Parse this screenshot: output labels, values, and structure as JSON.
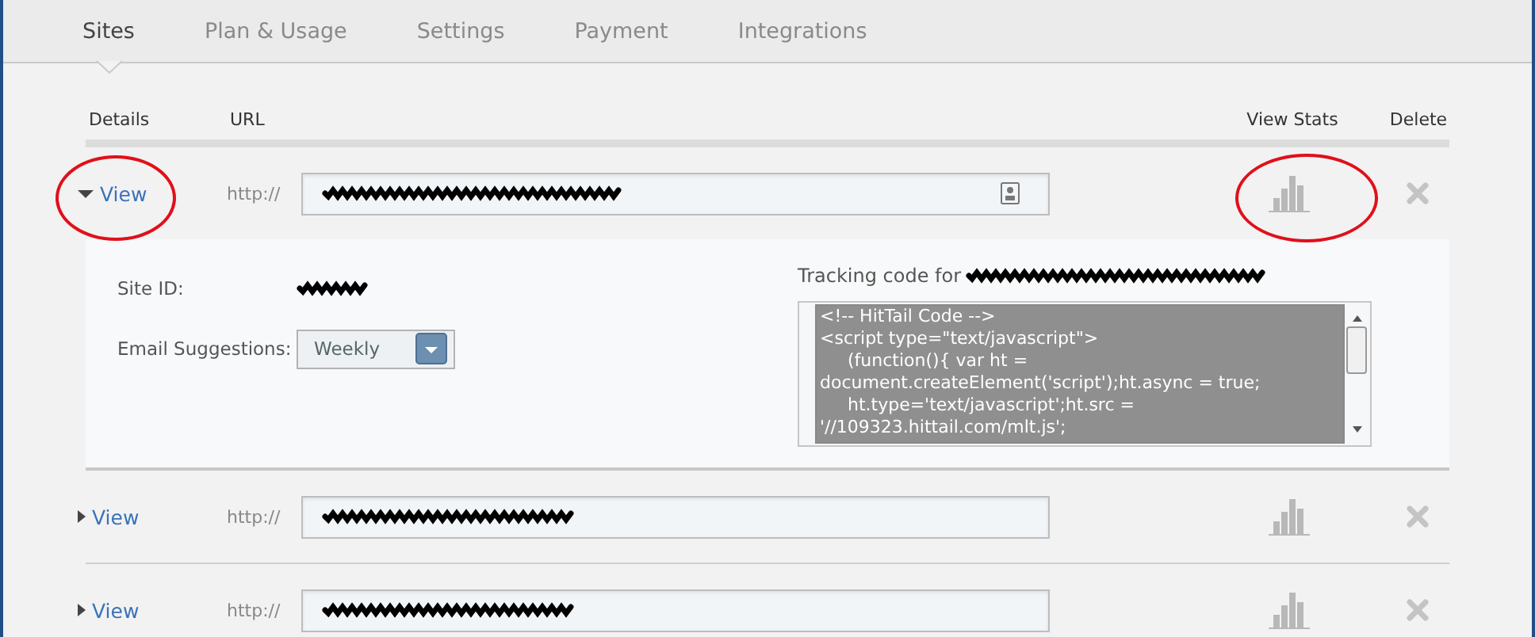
{
  "tabs": [
    {
      "label": "Sites",
      "selected": true
    },
    {
      "label": "Plan & Usage",
      "selected": false
    },
    {
      "label": "Settings",
      "selected": false
    },
    {
      "label": "Payment",
      "selected": false
    },
    {
      "label": "Integrations",
      "selected": false
    }
  ],
  "columns": [
    "Details",
    "URL",
    "View Stats",
    "Delete"
  ],
  "sites": [
    {
      "toggle": "View",
      "expanded": true,
      "prefix": "http://",
      "view_circled": true,
      "stats_circled": true,
      "details": {
        "site_id_label": "Site ID:",
        "email_label": "Email Suggestions:",
        "email_value": "Weekly",
        "tracking_label": "Tracking code for",
        "code_lines": [
          "<!-- HitTail Code -->",
          "<script type=\"text/javascript\">",
          "     (function(){ var ht =",
          "document.createElement('script');ht.async = true;",
          "     ht.type='text/javascript';ht.src =",
          "'//109323.hittail.com/mlt.js';"
        ]
      }
    },
    {
      "toggle": "View",
      "expanded": false,
      "prefix": "http://",
      "view_circled": false,
      "stats_circled": false
    },
    {
      "toggle": "View",
      "expanded": false,
      "prefix": "http://",
      "view_circled": false,
      "stats_circled": false
    }
  ]
}
